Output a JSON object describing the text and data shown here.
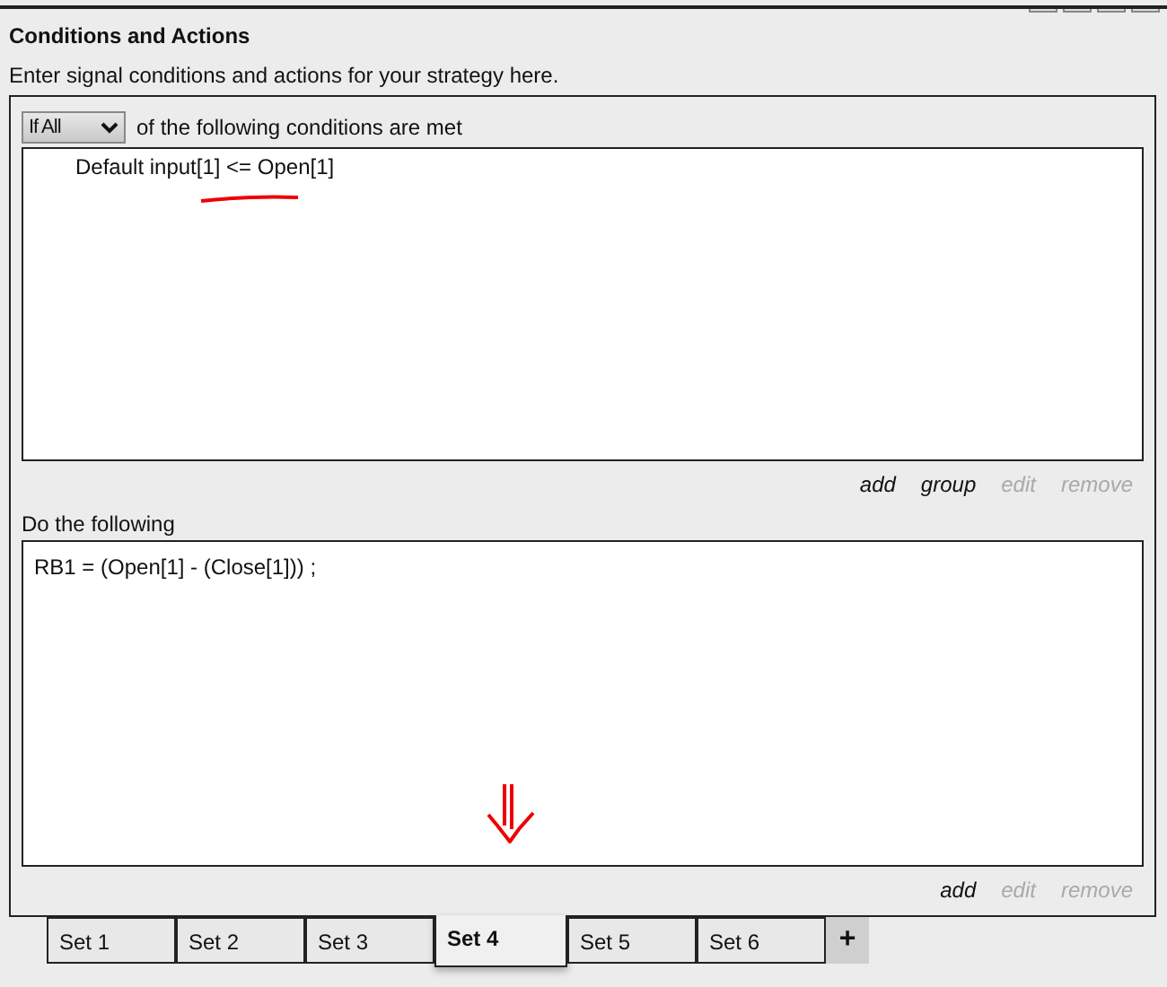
{
  "title": "Conditions and Actions",
  "subtitle": "Enter signal conditions and actions for your strategy here.",
  "conditions": {
    "match_select": "If All",
    "match_text": "of the following conditions are met",
    "items": [
      "Default input[1] <= Open[1]"
    ],
    "links": [
      {
        "label": "add",
        "disabled": false
      },
      {
        "label": "group",
        "disabled": false
      },
      {
        "label": "edit",
        "disabled": true
      },
      {
        "label": "remove",
        "disabled": true
      }
    ]
  },
  "actions": {
    "heading": "Do the following",
    "items": [
      "RB1 = (Open[1] - (Close[1])) ;"
    ],
    "links": [
      {
        "label": "add",
        "disabled": false
      },
      {
        "label": "edit",
        "disabled": true
      },
      {
        "label": "remove",
        "disabled": true
      }
    ]
  },
  "tabs": [
    {
      "label": "Set 1",
      "selected": false
    },
    {
      "label": "Set 2",
      "selected": false
    },
    {
      "label": "Set 3",
      "selected": false
    },
    {
      "label": "Set 4",
      "selected": true
    },
    {
      "label": "Set 5",
      "selected": false
    },
    {
      "label": "Set 6",
      "selected": false
    }
  ],
  "add_tab": "+"
}
